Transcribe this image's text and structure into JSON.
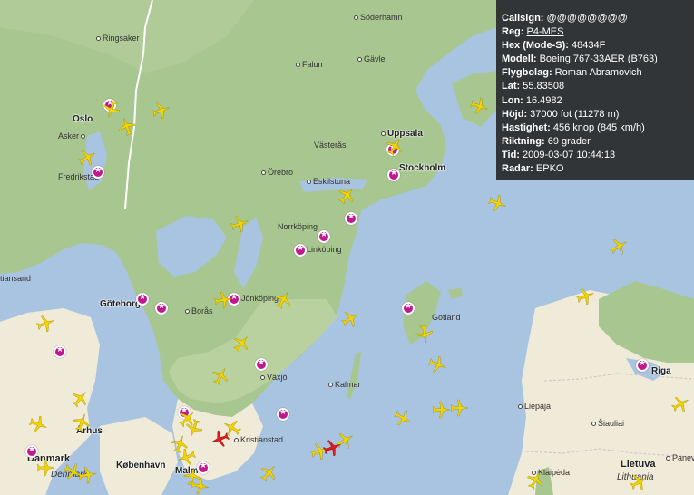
{
  "info": {
    "callsign": {
      "label": "Callsign:",
      "value": "@@@@@@@@"
    },
    "reg": {
      "label": "Reg:",
      "value": "P4-MES"
    },
    "hex": {
      "label": "Hex (Mode-S):",
      "value": "48434F"
    },
    "model": {
      "label": "Modell:",
      "value": "Boeing 767-33AER (B763)"
    },
    "airline": {
      "label": "Flygbolag:",
      "value": "Roman Abramovich"
    },
    "lat": {
      "label": "Lat:",
      "value": "55.83508"
    },
    "lon": {
      "label": "Lon:",
      "value": "16.4982"
    },
    "altitude": {
      "label": "Höjd:",
      "value": "37000 fot (11278 m)"
    },
    "speed": {
      "label": "Hastighet:",
      "value": "456 knop (845 km/h)"
    },
    "heading": {
      "label": "Riktning:",
      "value": "69 grader"
    },
    "time": {
      "label": "Tid:",
      "value": "2009-03-07 10:44:13"
    },
    "radar": {
      "label": "Radar:",
      "value": "EPKO"
    }
  },
  "cities": {
    "soderhamn": "Söderhamn",
    "ringsaker": "Ringsaker",
    "falun": "Falun",
    "gavle": "Gävle",
    "oslo": "Oslo",
    "asker": "Asker",
    "uppsala": "Uppsala",
    "vasteras": "Västerås",
    "stockholm": "Stockholm",
    "fredrikstad": "Fredrikstad",
    "orebro": "Örebro",
    "eskilstuna": "Eskilstuna",
    "norrkoping": "Norrköping",
    "linkoping": "Linköping",
    "kristiansand": "tiansand",
    "goteborg": "Göteborg",
    "boras": "Borås",
    "jonkoping": "Jönköping",
    "gotland": "Gotland",
    "riga": "Riga",
    "vaxjo": "Växjö",
    "kalmar": "Kalmar",
    "liepaja": "Liepāja",
    "arhus": "Århus",
    "siauliai": "Šiauliai",
    "kristianstad": "Kristianstad",
    "danmark": "Danmark",
    "denmark": "Denmark",
    "kobenhavn": "København",
    "malmo": "Malmö",
    "klaipeda": "Klaipėda",
    "panevezys": "Panevė",
    "lietuva": "Lietuva",
    "lithuania": "Lithuania"
  },
  "colors": {
    "sea": "#a9c4e0",
    "land_forest": "#a8c690",
    "land_open": "#f0ebd8",
    "plane": "#f2d500",
    "plane_selected": "#e21b1b",
    "airport": "#c2188f",
    "info_bg": "#282828"
  },
  "icons": {
    "plane": "airplane-icon",
    "airport": "airport-star-icon"
  }
}
